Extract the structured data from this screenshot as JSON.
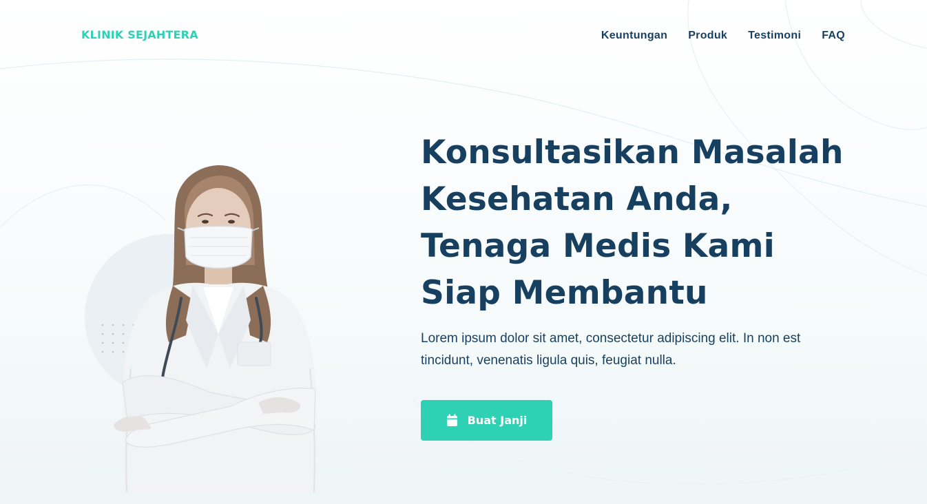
{
  "header": {
    "brand": "KLINIK SEJAHTERA",
    "nav": [
      {
        "label": "Keuntungan"
      },
      {
        "label": "Produk"
      },
      {
        "label": "Testimoni"
      },
      {
        "label": "FAQ"
      }
    ]
  },
  "hero": {
    "title": "Konsultasikan Masalah Kesehatan Anda, Tenaga Medis Kami Siap Membantu",
    "description": "Lorem ipsum dolor sit amet, consectetur adipiscing elit. In non est tincidunt, venenatis ligula quis, feugiat nulla.",
    "cta_label": "Buat Janji",
    "cta_icon": "calendar-icon"
  },
  "colors": {
    "accent": "#2fd1b5",
    "heading": "#173f5f",
    "text": "#173f5f",
    "background": "#f7fbfc"
  }
}
